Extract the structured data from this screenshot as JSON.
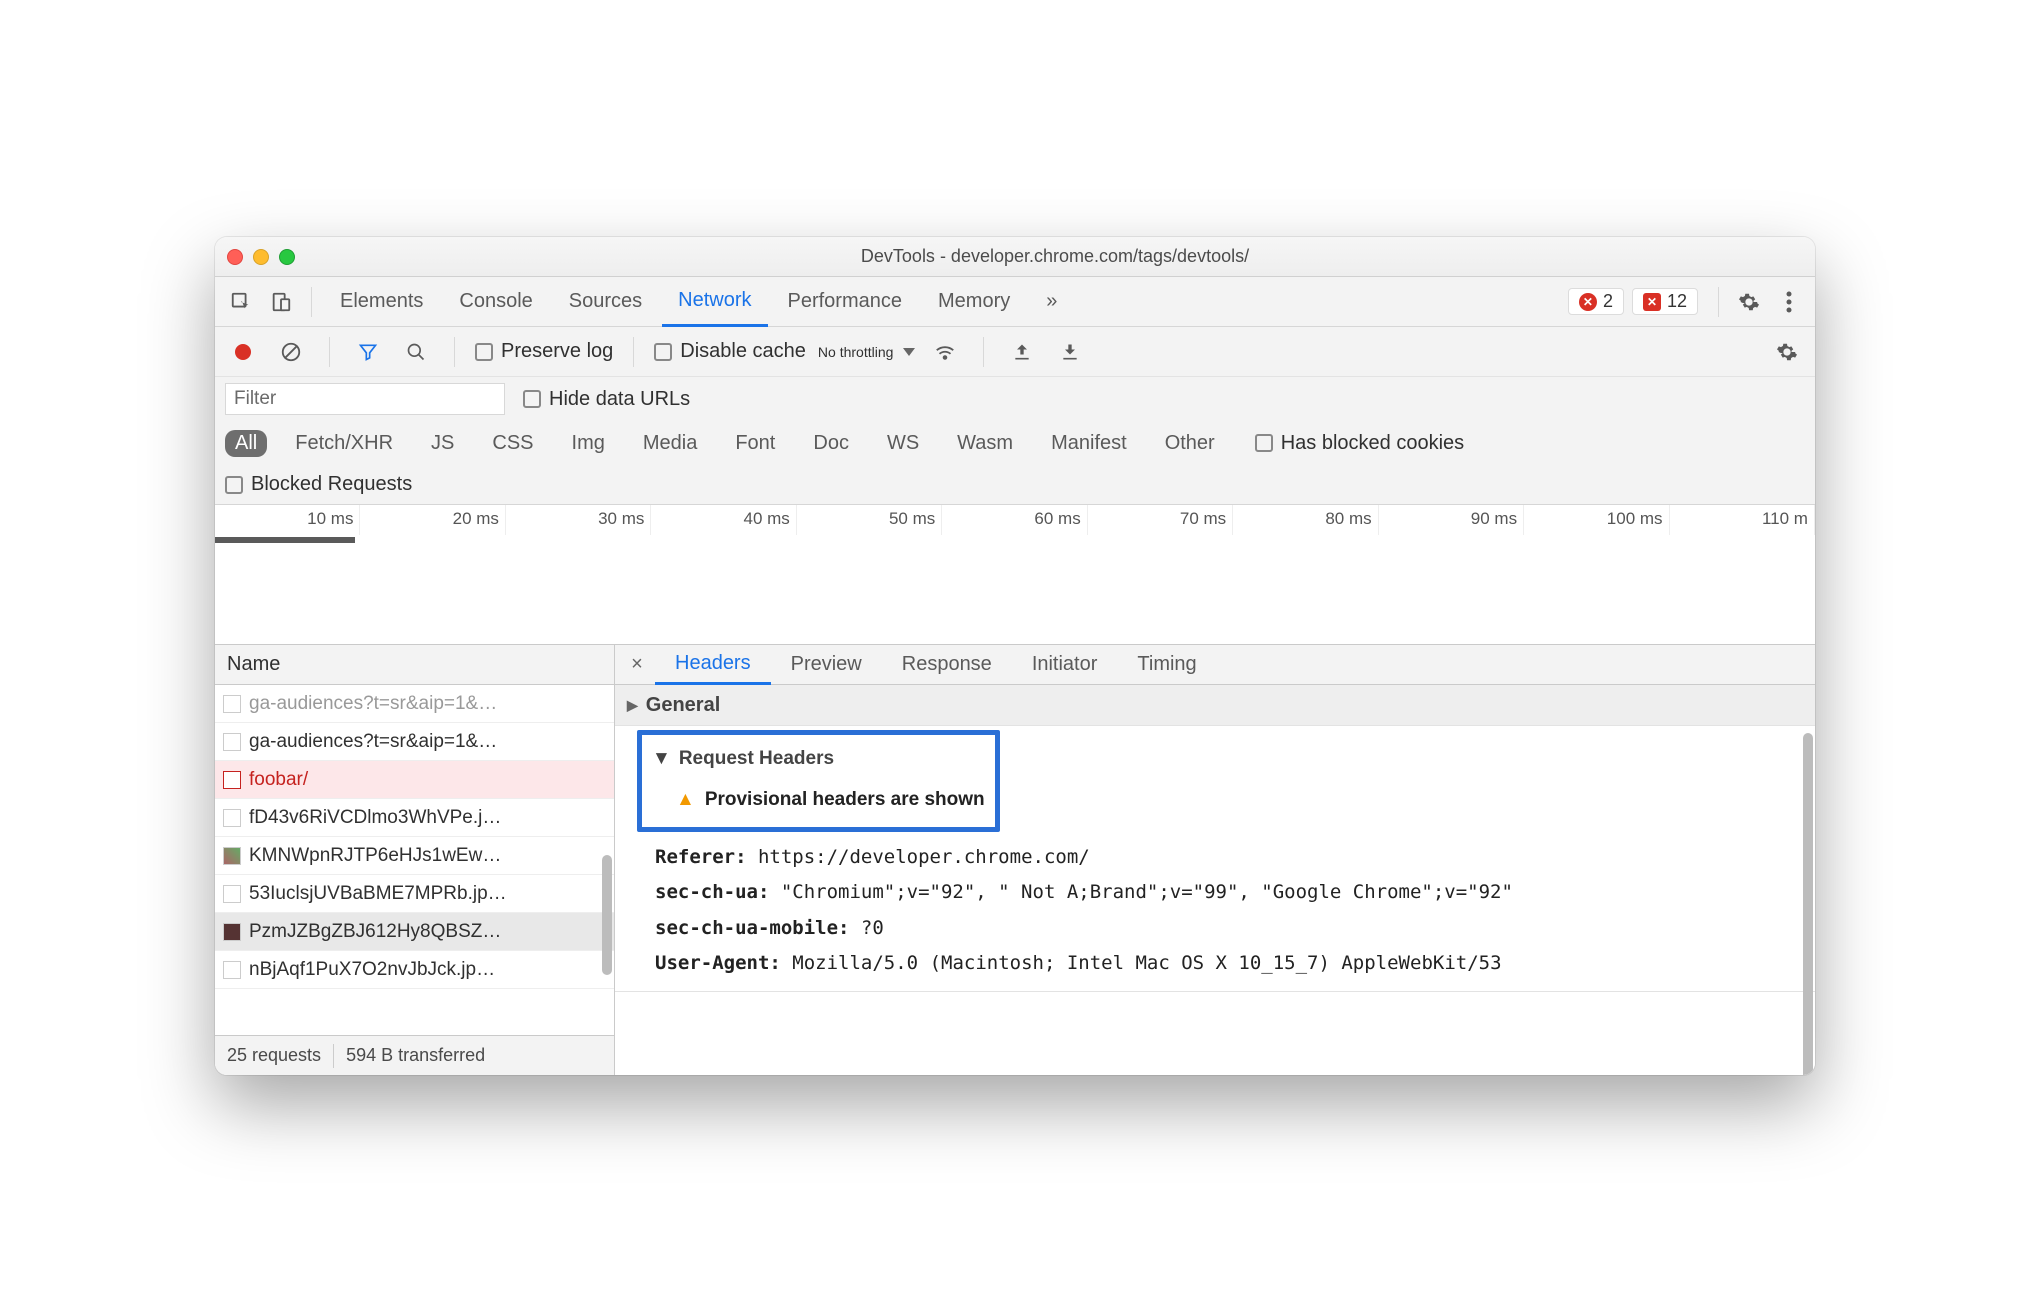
{
  "window": {
    "title": "DevTools - developer.chrome.com/tags/devtools/"
  },
  "tabs": {
    "elements": "Elements",
    "console": "Console",
    "sources": "Sources",
    "network": "Network",
    "performance": "Performance",
    "memory": "Memory",
    "more": "»"
  },
  "badges": {
    "errors": "2",
    "issues": "12"
  },
  "toolbar": {
    "preserve_log": "Preserve log",
    "disable_cache": "Disable cache",
    "throttling": "No throttling"
  },
  "filter": {
    "placeholder": "Filter",
    "hide_data_urls": "Hide data URLs"
  },
  "types": {
    "all": "All",
    "fetchxhr": "Fetch/XHR",
    "js": "JS",
    "css": "CSS",
    "img": "Img",
    "media": "Media",
    "font": "Font",
    "doc": "Doc",
    "ws": "WS",
    "wasm": "Wasm",
    "manifest": "Manifest",
    "other": "Other",
    "has_blocked_cookies": "Has blocked cookies",
    "blocked_requests": "Blocked Requests"
  },
  "timeline": {
    "ticks": [
      "10 ms",
      "20 ms",
      "30 ms",
      "40 ms",
      "50 ms",
      "60 ms",
      "70 ms",
      "80 ms",
      "90 ms",
      "100 ms",
      "110 m"
    ]
  },
  "request_list": {
    "header": "Name",
    "items": [
      "ga-audiences?t=sr&aip=1&…",
      "ga-audiences?t=sr&aip=1&…",
      "foobar/",
      "fD43v6RiVCDlmo3WhVPe.j…",
      "KMNWpnRJTP6eHJs1wEw…",
      "53IuclsjUVBaBME7MPRb.jp…",
      "PzmJZBgZBJ612Hy8QBSZ…",
      "nBjAqf1PuX7O2nvJbJck.jp…"
    ],
    "error_index": 2,
    "selected_index": 6
  },
  "status": {
    "requests": "25 requests",
    "transferred": "594 B transferred"
  },
  "detail_tabs": {
    "headers": "Headers",
    "preview": "Preview",
    "response": "Response",
    "initiator": "Initiator",
    "timing": "Timing"
  },
  "sections": {
    "general": "General",
    "request_headers": "Request Headers",
    "provisional": "Provisional headers are shown"
  },
  "headers": {
    "referer_k": "Referer:",
    "referer_v": "https://developer.chrome.com/",
    "secchua_k": "sec-ch-ua:",
    "secchua_v": "\"Chromium\";v=\"92\", \" Not A;Brand\";v=\"99\", \"Google Chrome\";v=\"92\"",
    "secchuam_k": "sec-ch-ua-mobile:",
    "secchuam_v": "?0",
    "ua_k": "User-Agent:",
    "ua_v": "Mozilla/5.0 (Macintosh; Intel Mac OS X 10_15_7) AppleWebKit/53"
  }
}
